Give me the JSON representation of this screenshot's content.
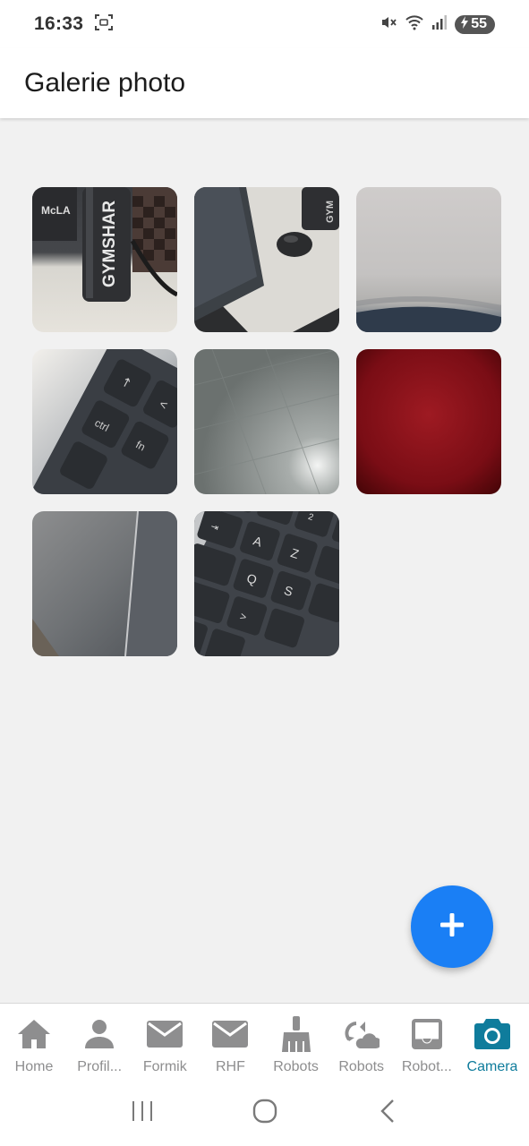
{
  "status_bar": {
    "time": "16:33",
    "battery": "55"
  },
  "header": {
    "title": "Galerie photo"
  },
  "gallery": {
    "photos": [
      {
        "icon": "photo-water-bottle"
      },
      {
        "icon": "photo-desk-mouse"
      },
      {
        "icon": "photo-blurry-grey"
      },
      {
        "icon": "photo-keyboard-ctrl"
      },
      {
        "icon": "photo-grey-surface"
      },
      {
        "icon": "photo-dark-red"
      },
      {
        "icon": "photo-laptop-edge"
      },
      {
        "icon": "photo-keyboard-azerty"
      }
    ]
  },
  "fab": {
    "icon": "plus-icon",
    "color": "#1a7ff5"
  },
  "tabs": [
    {
      "label": "Home",
      "icon": "home-icon",
      "active": false
    },
    {
      "label": "Profil...",
      "icon": "person-icon",
      "active": false
    },
    {
      "label": "Formik",
      "icon": "mail-icon",
      "active": false
    },
    {
      "label": "RHF",
      "icon": "mail-icon",
      "active": false
    },
    {
      "label": "Robots",
      "icon": "broom-icon",
      "active": false
    },
    {
      "label": "Robots",
      "icon": "cloud-sync-icon",
      "active": false
    },
    {
      "label": "Robot...",
      "icon": "inbox-icon",
      "active": false
    },
    {
      "label": "Camera",
      "icon": "camera-icon",
      "active": true
    }
  ],
  "colors": {
    "active_tab": "#0f7c9c",
    "inactive_tab": "#8e8e8f",
    "background": "#f1f1f1"
  }
}
